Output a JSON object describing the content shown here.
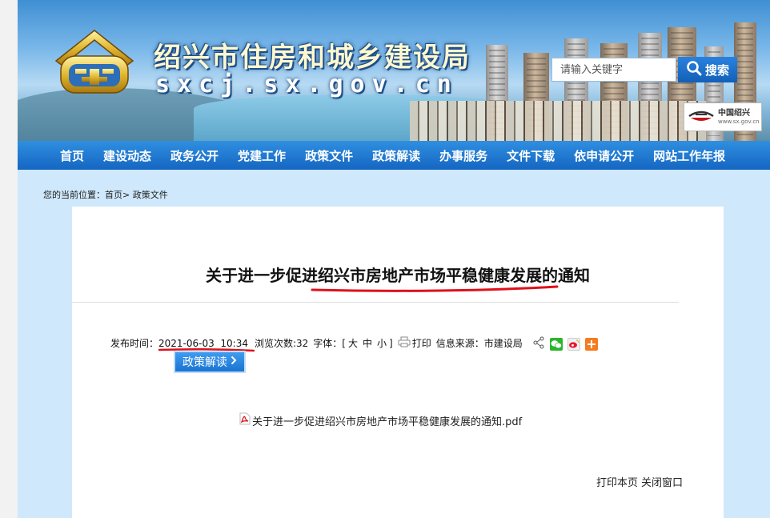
{
  "header": {
    "site_title": "绍兴市住房和城乡建设局",
    "site_domain": "sxcj.sx.gov.cn",
    "logo_icon": "bureau-emblem-icon",
    "search_placeholder": "请输入关键字",
    "search_button_label": "搜索",
    "search_icon": "magnifier-icon",
    "badge_label": "中国绍兴",
    "badge_url_text": "www.sx.gov.cn"
  },
  "nav": {
    "items": [
      "首页",
      "建设动态",
      "政务公开",
      "党建工作",
      "政策文件",
      "政策解读",
      "办事服务",
      "文件下载",
      "依申请公开",
      "网站工作年报"
    ]
  },
  "breadcrumb": {
    "prefix": "您的当前位置：",
    "home": "首页",
    "separator": ">",
    "current": " 政策文件"
  },
  "article": {
    "title": "关于进一步促进绍兴市房地产市场平稳健康发展的通知",
    "meta": {
      "publish_label": "发布时间：",
      "publish_value": "2021-06-03  10:34",
      "views_label": "浏览次数:",
      "views_value": "32",
      "font_label": "字体：[",
      "font_large": "大",
      "font_medium": "中",
      "font_small": "小",
      "font_close": "]",
      "print_label": "打印",
      "source_label": "信息来源：",
      "source_value": "市建设局"
    },
    "policy_button_label": "政策解读",
    "attachment_name": "关于进一步促进绍兴市房地产市场平稳健康发展的通知.pdf"
  },
  "footer": {
    "print_page": "打印本页",
    "close_window": "关闭窗口"
  },
  "colors": {
    "nav_blue": "#1e78d3",
    "annotation_red": "#e0101a",
    "page_bg": "#cfe8fb"
  }
}
